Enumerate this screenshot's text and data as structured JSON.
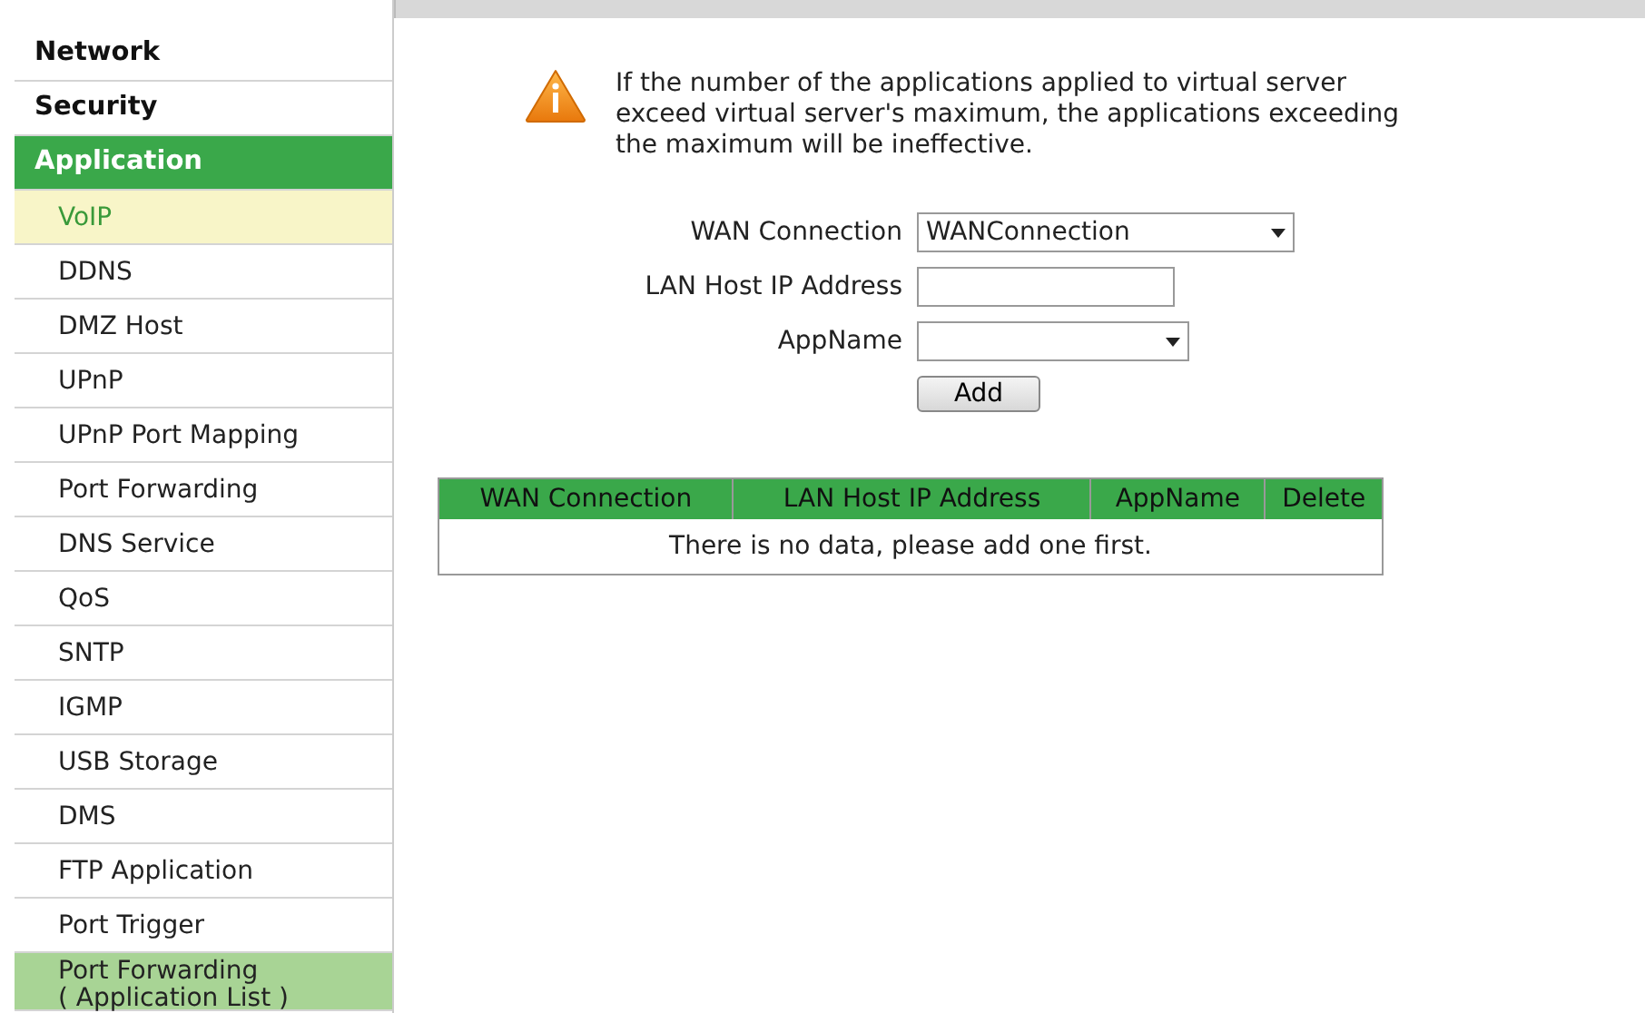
{
  "sidebar": {
    "items": [
      {
        "label": "Network",
        "kind": "group",
        "selected": false,
        "highlighted": false
      },
      {
        "label": "Security",
        "kind": "group",
        "selected": false,
        "highlighted": false
      },
      {
        "label": "Application",
        "kind": "group",
        "selected": true,
        "highlighted": false
      },
      {
        "label": "VoIP",
        "kind": "sub",
        "selected": false,
        "highlighted": true
      },
      {
        "label": "DDNS",
        "kind": "sub",
        "selected": false,
        "highlighted": false
      },
      {
        "label": "DMZ Host",
        "kind": "sub",
        "selected": false,
        "highlighted": false
      },
      {
        "label": "UPnP",
        "kind": "sub",
        "selected": false,
        "highlighted": false
      },
      {
        "label": "UPnP Port Mapping",
        "kind": "sub",
        "selected": false,
        "highlighted": false
      },
      {
        "label": "Port Forwarding",
        "kind": "sub",
        "selected": false,
        "highlighted": false
      },
      {
        "label": "DNS Service",
        "kind": "sub",
        "selected": false,
        "highlighted": false
      },
      {
        "label": "QoS",
        "kind": "sub",
        "selected": false,
        "highlighted": false
      },
      {
        "label": "SNTP",
        "kind": "sub",
        "selected": false,
        "highlighted": false
      },
      {
        "label": "IGMP",
        "kind": "sub",
        "selected": false,
        "highlighted": false
      },
      {
        "label": "USB Storage",
        "kind": "sub",
        "selected": false,
        "highlighted": false
      },
      {
        "label": "DMS",
        "kind": "sub",
        "selected": false,
        "highlighted": false
      },
      {
        "label": "FTP Application",
        "kind": "sub",
        "selected": false,
        "highlighted": false
      },
      {
        "label": "Port Trigger",
        "kind": "sub",
        "selected": false,
        "highlighted": false
      },
      {
        "label": "Port Forwarding\n( Application List )",
        "kind": "sub",
        "selected": true,
        "highlighted": false
      }
    ]
  },
  "notice": "If the number of the applications applied to virtual server exceed virtual server's maximum, the applications exceeding the maximum will be ineffective.",
  "form": {
    "fields": [
      {
        "label": "WAN Connection",
        "kind": "select",
        "value": "WANConnection"
      },
      {
        "label": "LAN Host IP Address",
        "kind": "text"
      },
      {
        "label": "AppName",
        "kind": "select"
      }
    ],
    "button": "Add"
  },
  "table": {
    "columns": [
      "WAN Connection",
      "LAN Host IP Address",
      "AppName",
      "Delete"
    ],
    "empty_message": "There is no data, please add one first."
  }
}
